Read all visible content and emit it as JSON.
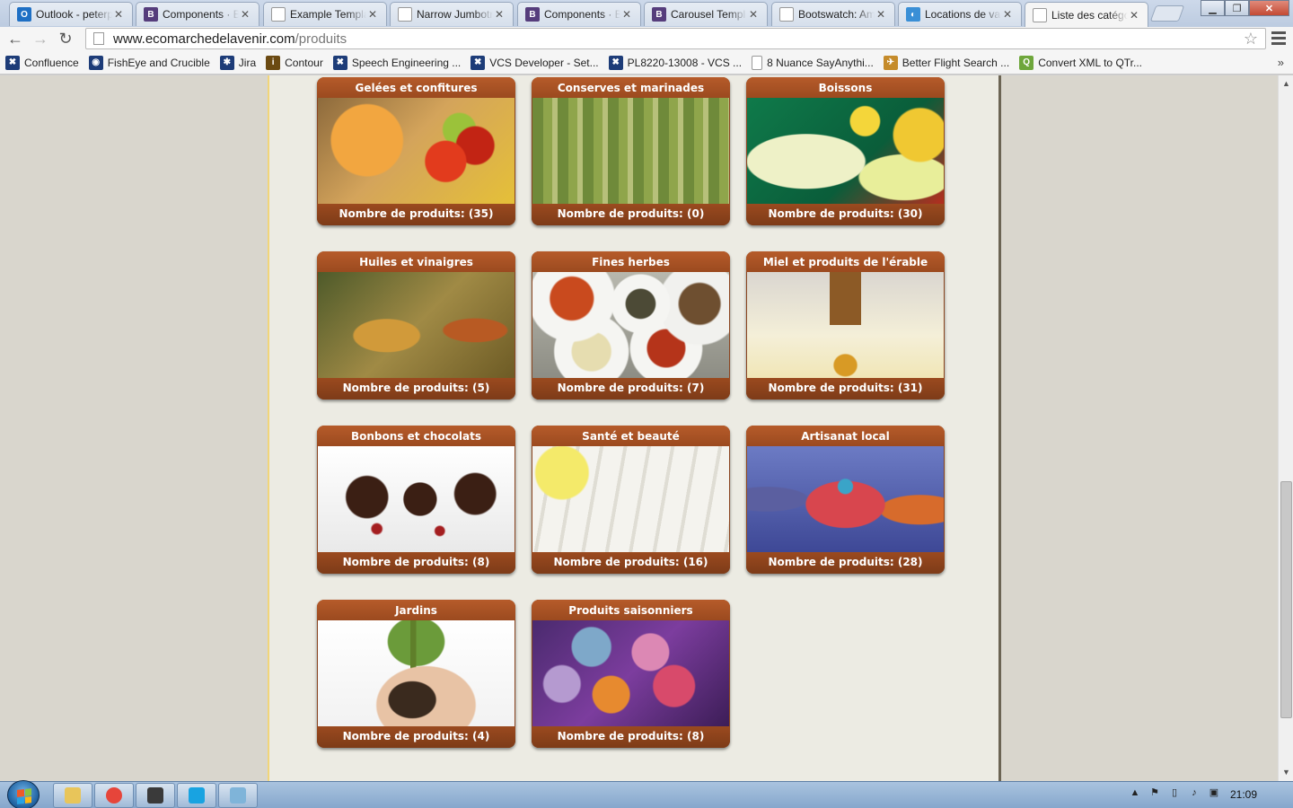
{
  "browser": {
    "tabs": [
      {
        "title": "Outlook - peterp",
        "icon": "outlook-icon",
        "color": "#1e6fc4",
        "glyph": "O"
      },
      {
        "title": "Components · B",
        "icon": "bootstrap-icon",
        "color": "#563d7c",
        "glyph": "B"
      },
      {
        "title": "Example Templa",
        "icon": "page-icon",
        "color": "#ffffff",
        "glyph": ""
      },
      {
        "title": "Narrow Jumbotr",
        "icon": "page-icon",
        "color": "#ffffff",
        "glyph": ""
      },
      {
        "title": "Components · B",
        "icon": "bootstrap-icon",
        "color": "#563d7c",
        "glyph": "B"
      },
      {
        "title": "Carousel Templ",
        "icon": "bootstrap-icon",
        "color": "#563d7c",
        "glyph": "B"
      },
      {
        "title": "Bootswatch: Am",
        "icon": "page-icon",
        "color": "#ffffff",
        "glyph": ""
      },
      {
        "title": "Locations de vac",
        "icon": "globe-icon",
        "color": "#3a8fd6",
        "glyph": "◐"
      },
      {
        "title": "Liste des catégor",
        "icon": "page-icon",
        "color": "#ffffff",
        "glyph": ""
      }
    ],
    "active_tab": 8,
    "url_host": "www.ecomarchedelavenir.com",
    "url_path": "/produits",
    "back_icon": "back-arrow-icon",
    "forward_icon": "forward-arrow-icon",
    "reload_icon": "reload-icon"
  },
  "bookmarks": [
    {
      "label": "Confluence",
      "icon": "confluence-icon",
      "color": "#1d3c78",
      "glyph": "✖"
    },
    {
      "label": "FishEye and Crucible",
      "icon": "fisheye-icon",
      "color": "#1d3c78",
      "glyph": "◉"
    },
    {
      "label": "Jira",
      "icon": "jira-icon",
      "color": "#1d3c78",
      "glyph": "✱"
    },
    {
      "label": "Contour",
      "icon": "contour-icon",
      "color": "#6b4a12",
      "glyph": "i"
    },
    {
      "label": "Speech Engineering ...",
      "icon": "confluence-icon",
      "color": "#1d3c78",
      "glyph": "✖"
    },
    {
      "label": "VCS Developer - Set...",
      "icon": "confluence-icon",
      "color": "#1d3c78",
      "glyph": "✖"
    },
    {
      "label": "PL8220-13008 - VCS ...",
      "icon": "confluence-icon",
      "color": "#1d3c78",
      "glyph": "✖"
    },
    {
      "label": "8 Nuance SayAnythi...",
      "icon": "page-icon",
      "color": "#ffffff",
      "glyph": ""
    },
    {
      "label": "Better Flight Search ...",
      "icon": "flight-icon",
      "color": "#c58b2a",
      "glyph": "✈"
    },
    {
      "label": "Convert XML to QTr...",
      "icon": "qt-icon",
      "color": "#6ea63b",
      "glyph": "Q"
    }
  ],
  "bookmarks_more": "»",
  "categories": [
    {
      "title": "Gelées et confitures",
      "count_label": "Nombre de produits: (35)"
    },
    {
      "title": "Conserves et marinades",
      "count_label": "Nombre de produits: (0)"
    },
    {
      "title": "Boissons",
      "count_label": "Nombre de produits: (30)"
    },
    {
      "title": "Huiles et vinaigres",
      "count_label": "Nombre de produits: (5)"
    },
    {
      "title": "Fines herbes",
      "count_label": "Nombre de produits: (7)"
    },
    {
      "title": "Miel et produits de l'érable",
      "count_label": "Nombre de produits: (31)"
    },
    {
      "title": "Bonbons et chocolats",
      "count_label": "Nombre de produits: (8)"
    },
    {
      "title": "Santé et beauté",
      "count_label": "Nombre de produits: (16)"
    },
    {
      "title": "Artisanat local",
      "count_label": "Nombre de produits: (28)"
    },
    {
      "title": "Jardins",
      "count_label": "Nombre de produits: (4)"
    },
    {
      "title": "Produits saisonniers",
      "count_label": "Nombre de produits: (8)"
    }
  ],
  "taskbar": {
    "clock": "21:09",
    "apps": [
      "explorer-icon",
      "chrome-icon",
      "terminal-icon",
      "skype-icon",
      "paint-icon"
    ]
  },
  "colors": {
    "card_header": "#a55224",
    "page_background": "#ecebe3",
    "page_border": "#f1d57a"
  }
}
